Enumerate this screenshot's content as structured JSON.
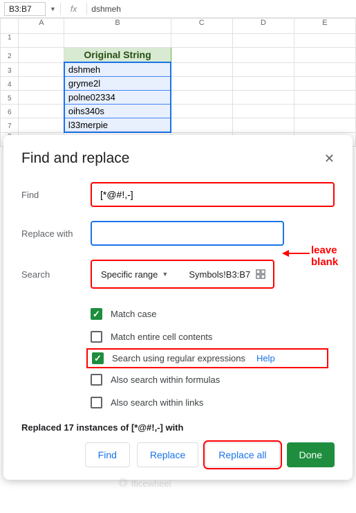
{
  "nameBox": "B3:B7",
  "formulaBar": "dshmeh",
  "cols": [
    "",
    "A",
    "B",
    "C",
    "D",
    "E"
  ],
  "rows": [
    "1",
    "2",
    "3",
    "4",
    "5",
    "6",
    "7",
    "8"
  ],
  "headerCell": "Original String",
  "dataCells": [
    "dshmeh",
    "gryme2l",
    "polne02334",
    "oihs340s",
    "l33merpie"
  ],
  "dialog": {
    "title": "Find and replace",
    "findLabel": "Find",
    "findValue": "[*@#!,-]",
    "replaceLabel": "Replace with",
    "replaceValue": "",
    "searchLabel": "Search",
    "rangeMode": "Specific range",
    "rangeValue": "Symbols!B3:B7",
    "opts": {
      "matchCase": "Match case",
      "matchEntire": "Match entire cell contents",
      "regex": "Search using regular expressions",
      "help": "Help",
      "formulas": "Also search within formulas",
      "links": "Also search within links"
    },
    "status": "Replaced 17 instances of [*@#!,-] with",
    "btns": {
      "find": "Find",
      "replace": "Replace",
      "replaceAll": "Replace all",
      "done": "Done"
    }
  },
  "annotation": "leave blank",
  "watermark": "fficewheel",
  "chart_data": {
    "type": "table",
    "title": "Original String",
    "columns": [
      "Original String"
    ],
    "rows": [
      [
        "dshmeh"
      ],
      [
        "gryme2l"
      ],
      [
        "polne02334"
      ],
      [
        "oihs340s"
      ],
      [
        "l33merpie"
      ]
    ]
  }
}
